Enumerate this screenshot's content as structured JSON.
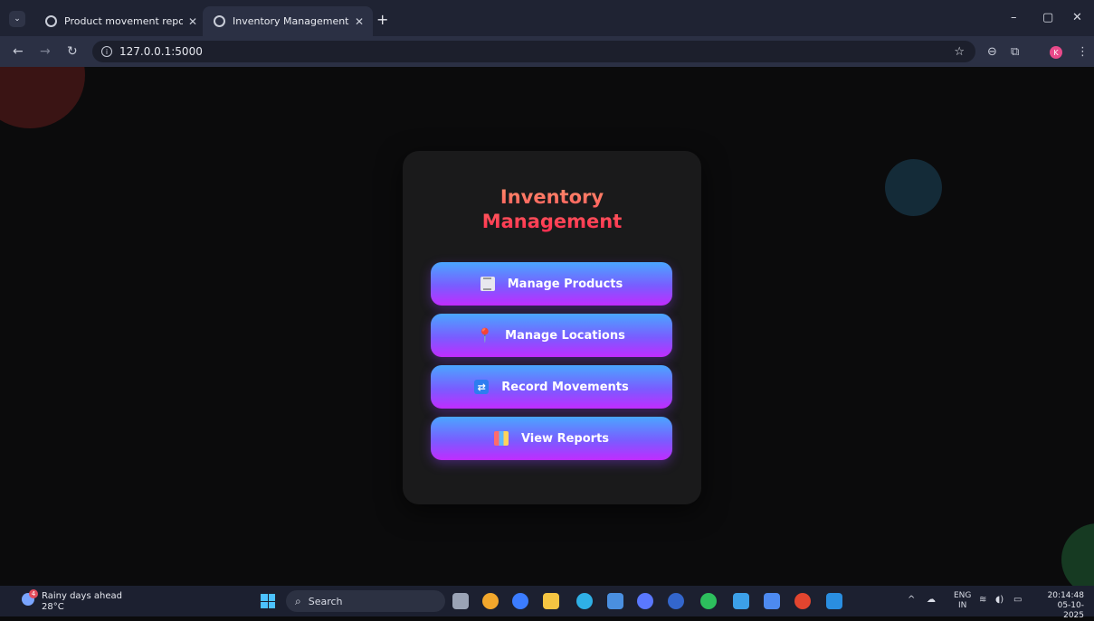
{
  "browser": {
    "tabs": [
      {
        "title": "Product movement report",
        "active": false
      },
      {
        "title": "Inventory Management System",
        "active": true
      }
    ],
    "new_tab": "+",
    "url": "127.0.0.1:5000",
    "profile_initial": "K",
    "window_controls": {
      "minimize": "–",
      "restore": "▢",
      "close": "✕"
    }
  },
  "page": {
    "title_line1": "Inventory",
    "title_line2": "Management",
    "buttons": [
      {
        "label": "Manage Products",
        "icon": "receipt-icon"
      },
      {
        "label": "Manage Locations",
        "icon": "pin-icon"
      },
      {
        "label": "Record Movements",
        "icon": "repeat-icon"
      },
      {
        "label": "View Reports",
        "icon": "chart-icon"
      }
    ]
  },
  "taskbar": {
    "weather": {
      "headline": "Rainy days ahead",
      "temp": "28°C",
      "badge": "4"
    },
    "search_placeholder": "Search",
    "language": {
      "line1": "ENG",
      "line2": "IN"
    },
    "clock": {
      "time": "20:14:48",
      "date": "05-10-2025"
    }
  },
  "colors": {
    "title_gradient": [
      "#ff8f6b",
      "#ff2a4f"
    ],
    "button_gradient": [
      "#4aa6ff",
      "#7a5cff",
      "#c02cff"
    ],
    "card_bg": "#1a1a1b",
    "page_bg": "#0b0b0c"
  }
}
